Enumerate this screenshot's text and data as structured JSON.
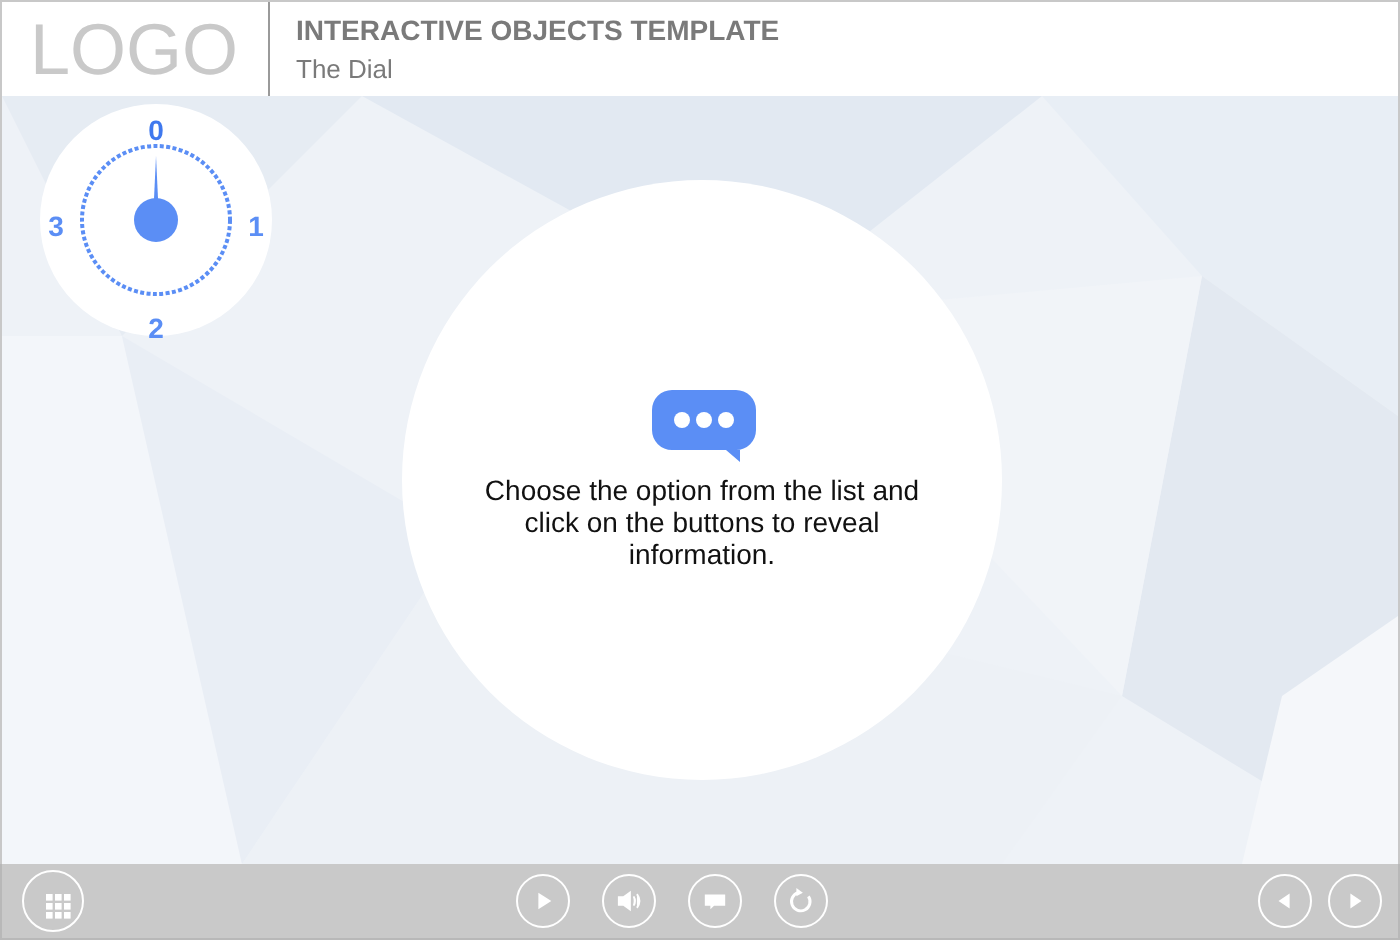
{
  "header": {
    "logo": "LOGO",
    "title": "INTERACTIVE OBJECTS TEMPLATE",
    "subtitle": "The Dial"
  },
  "dial": {
    "options": [
      {
        "label": "0",
        "selected": true
      },
      {
        "label": "1",
        "selected": false
      },
      {
        "label": "2",
        "selected": false
      },
      {
        "label": "3",
        "selected": false
      }
    ]
  },
  "message": {
    "text": "Choose the option from the list and click on the buttons to reveal information."
  },
  "player_bar": {
    "buttons": [
      {
        "kind": "menu"
      },
      {
        "kind": "play"
      },
      {
        "kind": "volume"
      },
      {
        "kind": "captions"
      },
      {
        "kind": "replay"
      },
      {
        "kind": "prev"
      },
      {
        "kind": "next"
      }
    ]
  }
}
